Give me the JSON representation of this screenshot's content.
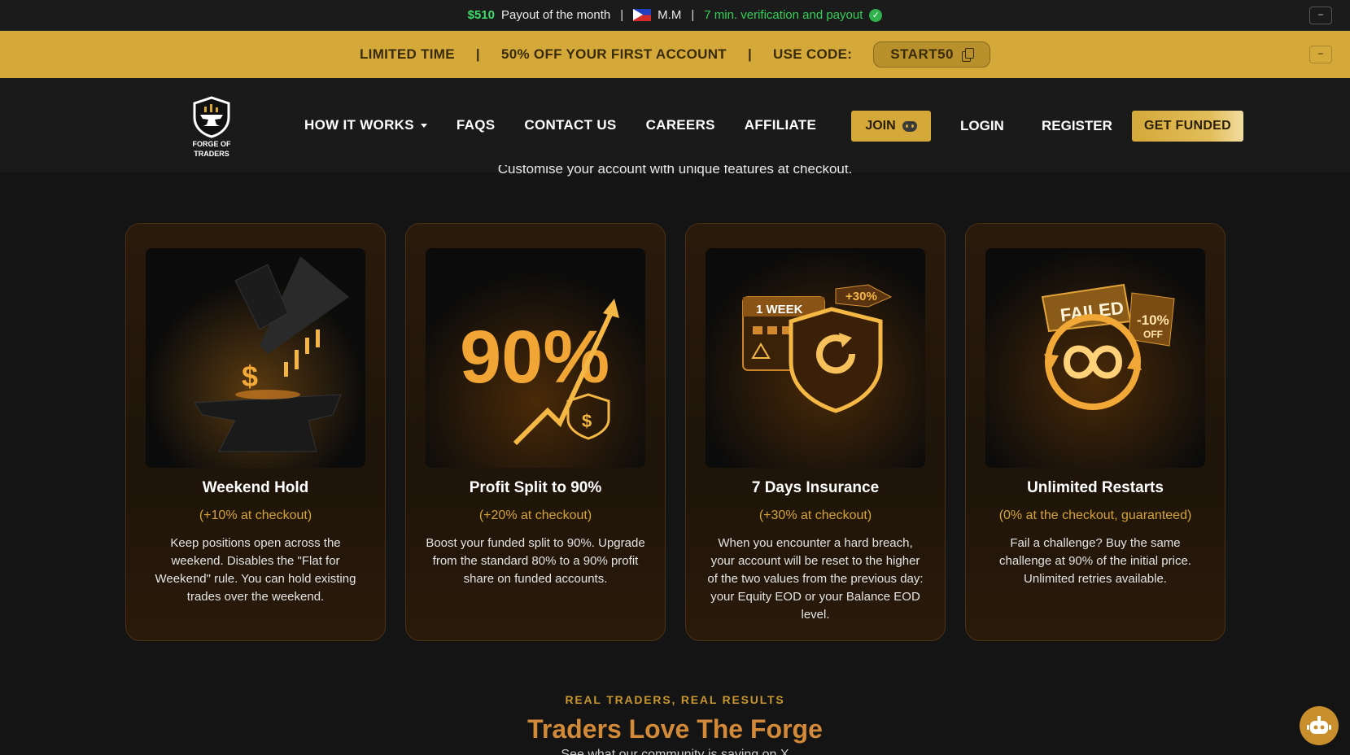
{
  "ticker": {
    "amount": "$510",
    "payout_text": "Payout of the month",
    "user": "M.M",
    "verification": "7 min. verification and payout",
    "check_glyph": "✓",
    "minimize_glyph": "−"
  },
  "promo": {
    "limited": "LIMITED TIME",
    "discount": "50% OFF YOUR FIRST ACCOUNT",
    "use_code": "USE CODE:",
    "code": "START50",
    "pipe": "|",
    "minimize_glyph": "−"
  },
  "nav": {
    "logo_line1": "FORGE OF",
    "logo_line2": "TRADERS",
    "links": [
      "HOW IT WORKS",
      "FAQS",
      "CONTACT US",
      "CAREERS",
      "AFFILIATE"
    ],
    "join": "JOIN",
    "login": "LOGIN",
    "register": "REGISTER",
    "get_funded": "GET FUNDED"
  },
  "content": {
    "caption": "Customise your account with unique features at checkout.",
    "cards": [
      {
        "title": "Weekend Hold",
        "sub": "(+10% at checkout)",
        "desc": "Keep positions open across the weekend. Disables the \"Flat for Weekend\" rule. You can hold existing trades over the weekend."
      },
      {
        "title": "Profit Split to 90%",
        "sub": "(+20% at checkout)",
        "desc": "Boost your funded split to 90%. Upgrade from the standard 80% to a 90% profit share on funded accounts.",
        "art_text": "90%"
      },
      {
        "title": "7 Days Insurance",
        "sub": "(+30% at checkout)",
        "desc": "When you encounter a hard breach, your account will be reset to the higher of the two values from the previous day: your Equity EOD or your Balance EOD level.",
        "art_week": "1 WEEK",
        "art_tag": "+30%"
      },
      {
        "title": "Unlimited Restarts",
        "sub": "(0% at the checkout, guaranteed)",
        "desc": "Fail a challenge? Buy the same challenge at 90% of the initial price. Unlimited retries available.",
        "art_failed": "FAILED",
        "art_off": "-10%",
        "art_off2": "OFF"
      }
    ]
  },
  "testimonials": {
    "kicker": "REAL TRADERS, REAL RESULTS",
    "title": "Traders Love The Forge",
    "sub": "See what our community is saying on X"
  },
  "colors": {
    "gold": "#d4a93a",
    "accent_orange": "#d38a38",
    "green": "#34d058"
  }
}
